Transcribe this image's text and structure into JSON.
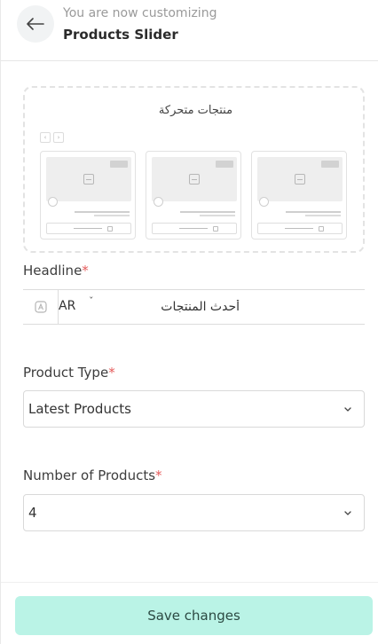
{
  "header": {
    "subtitle": "You are now customizing",
    "title": "Products Slider",
    "back_icon": "arrow-left-icon"
  },
  "preview": {
    "title": "منتجات متحركة",
    "arrow_prev": "‹",
    "arrow_next": "›"
  },
  "headline": {
    "label": "Headline",
    "required_mark": "*",
    "language": "AR",
    "value": "أحدث المنتجات",
    "translate_icon": "translate-icon"
  },
  "product_type": {
    "label": "Product Type",
    "required_mark": "*",
    "selected": "Latest Products"
  },
  "number_of_products": {
    "label": "Number of Products",
    "required_mark": "*",
    "selected": "4"
  },
  "footer": {
    "save_label": "Save changes"
  },
  "colors": {
    "accent": "#baf3e6",
    "required": "#e55b5b"
  }
}
